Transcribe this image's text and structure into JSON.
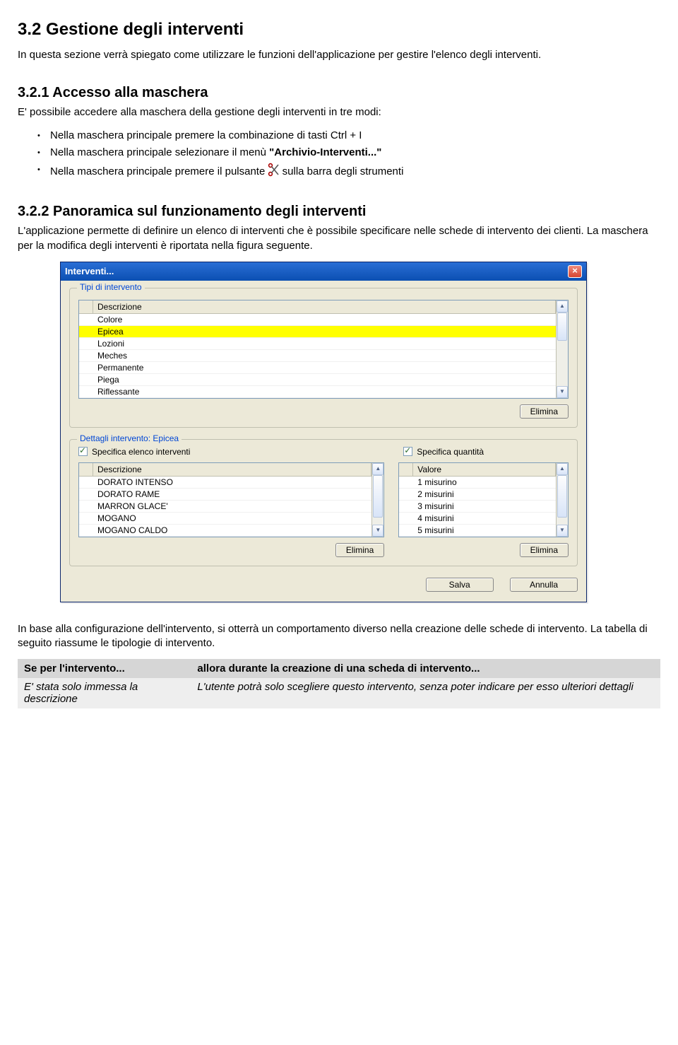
{
  "doc": {
    "h2": "3.2 Gestione degli interventi",
    "intro": "In questa sezione verrà spiegato come utilizzare le funzioni dell'applicazione per gestire l'elenco degli interventi.",
    "h3a": "3.2.1 Accesso alla maschera",
    "p321": "E' possibile accedere alla maschera della gestione degli interventi in tre modi:",
    "li1": "Nella maschera principale premere la combinazione di tasti Ctrl + I",
    "li2_a": "Nella maschera principale selezionare il menù ",
    "li2_b": "\"Archivio-Interventi...\"",
    "li3_a": "Nella maschera principale premere il pulsante ",
    "li3_b": " sulla barra degli strumenti",
    "h3b": "3.2.2 Panoramica sul funzionamento degli interventi",
    "p322": "L'applicazione permette di definire un elenco di interventi che è possibile specificare nelle schede di intervento dei clienti. La maschera per la modifica degli interventi è riportata nella figura seguente.",
    "pafter": "In base alla configurazione dell'intervento, si otterrà un comportamento diverso nella creazione delle schede di intervento. La tabella di seguito riassume le tipologie di intervento.",
    "tbl": {
      "h1": "Se per l'intervento...",
      "h2": "allora durante la creazione di una scheda di intervento...",
      "r1c1": "E' stata solo immessa la descrizione",
      "r1c2": "L'utente potrà solo scegliere questo intervento, senza poter indicare per esso ulteriori dettagli"
    }
  },
  "dlg": {
    "title": "Interventi...",
    "group_tipi": "Tipi di intervento",
    "col_descr": "Descrizione",
    "tipi_rows": [
      "Colore",
      "Epicea",
      "Lozioni",
      "Meches",
      "Permanente",
      "Piega",
      "Riflessante"
    ],
    "tipi_selected_index": 1,
    "btn_elimina": "Elimina",
    "group_detail": "Dettagli intervento: Epicea",
    "chk_elenco": "Specifica elenco interventi",
    "chk_quant": "Specifica quantità",
    "col_valore": "Valore",
    "elenco_rows": [
      "DORATO INTENSO",
      "DORATO RAME",
      "MARRON GLACE'",
      "MOGANO",
      "MOGANO CALDO"
    ],
    "quant_rows": [
      "1 misurino",
      "2 misurini",
      "3 misurini",
      "4 misurini",
      "5 misurini"
    ],
    "btn_salva": "Salva",
    "btn_annulla": "Annulla"
  }
}
